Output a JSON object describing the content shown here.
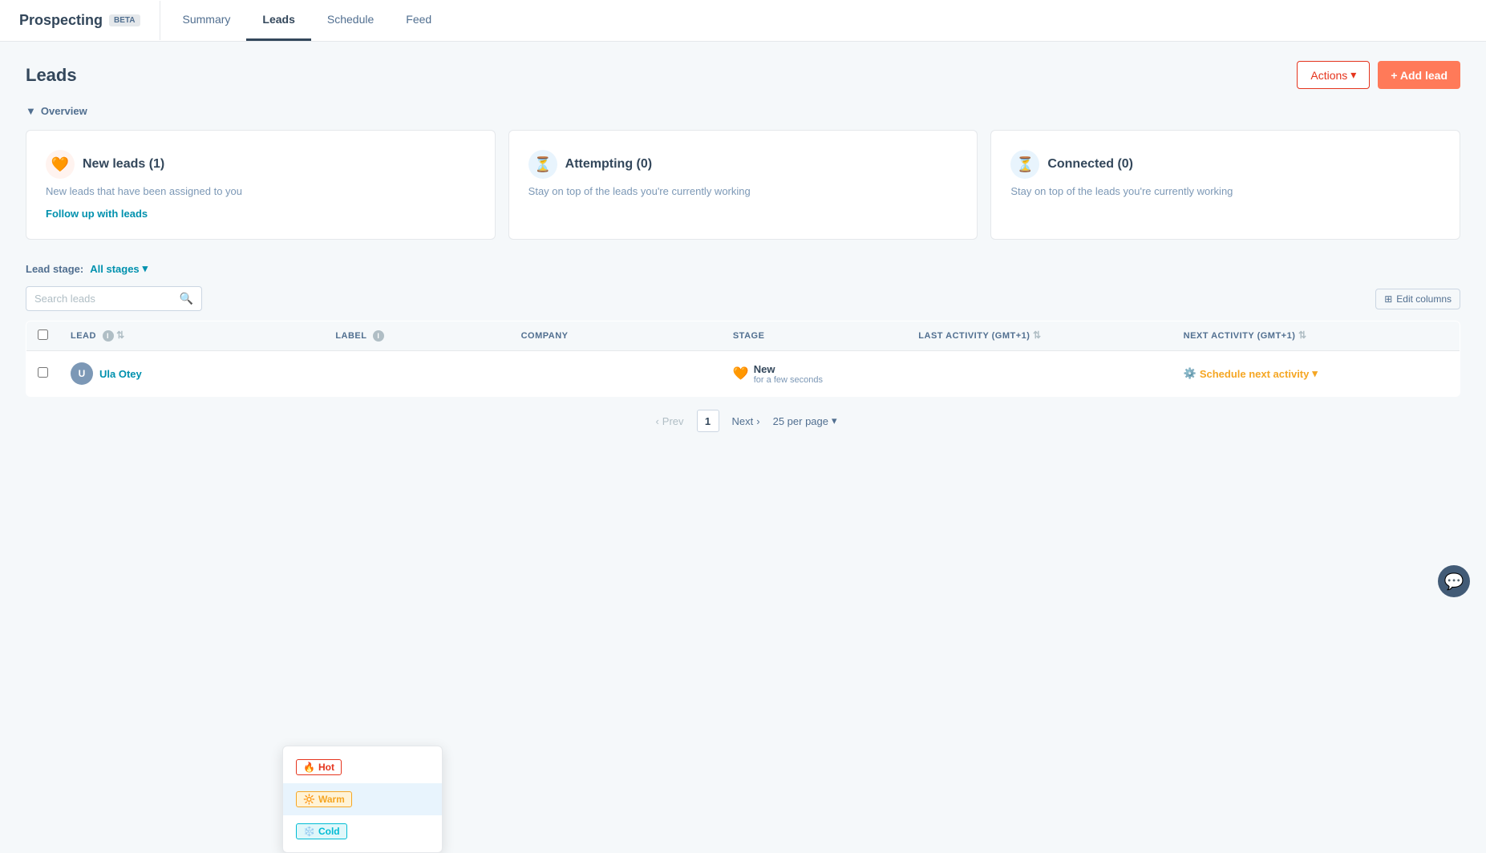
{
  "app": {
    "title": "Prospecting",
    "beta_label": "BETA"
  },
  "nav": {
    "tabs": [
      {
        "id": "summary",
        "label": "Summary",
        "active": false
      },
      {
        "id": "leads",
        "label": "Leads",
        "active": true
      },
      {
        "id": "schedule",
        "label": "Schedule",
        "active": false
      },
      {
        "id": "feed",
        "label": "Feed",
        "active": false
      }
    ]
  },
  "page": {
    "title": "Leads",
    "actions_button": "Actions",
    "add_lead_button": "+ Add lead"
  },
  "overview": {
    "section_label": "Overview",
    "cards": [
      {
        "id": "new-leads",
        "icon": "🧡",
        "icon_type": "orange",
        "title": "New leads (1)",
        "description": "New leads that have been assigned to you",
        "link": "Follow up with leads"
      },
      {
        "id": "attempting",
        "icon": "⏳",
        "icon_type": "blue",
        "title": "Attempting (0)",
        "description": "Stay on top of the leads you're currently working",
        "link": null
      },
      {
        "id": "connected",
        "icon": "⏳",
        "icon_type": "blue",
        "title": "Connected (0)",
        "description": "Stay on top of the leads you're currently working",
        "link": null
      }
    ]
  },
  "filter": {
    "label": "Lead stage:",
    "value": "All stages",
    "chevron": "▾"
  },
  "search": {
    "placeholder": "Search leads"
  },
  "edit_columns_label": "Edit columns",
  "table": {
    "columns": [
      {
        "id": "lead",
        "label": "LEAD",
        "has_info": true,
        "sortable": true
      },
      {
        "id": "label",
        "label": "LABEL",
        "has_info": true,
        "sortable": false
      },
      {
        "id": "company",
        "label": "COMPANY",
        "has_info": false,
        "sortable": false
      },
      {
        "id": "stage",
        "label": "STAGE",
        "has_info": false,
        "sortable": false
      },
      {
        "id": "last_activity",
        "label": "LAST ACTIVITY (GMT+1)",
        "has_info": false,
        "sortable": true
      },
      {
        "id": "next_activity",
        "label": "NEXT ACTIVITY (GMT+1)",
        "has_info": false,
        "sortable": true
      }
    ],
    "rows": [
      {
        "id": "row-1",
        "avatar_initials": "U",
        "name": "Ula Otey",
        "label": "",
        "company": "",
        "stage_icon": "🧡",
        "stage_text": "New",
        "stage_sub": "for a few seconds",
        "last_activity": "",
        "next_activity": "Schedule next activity",
        "next_activity_suffix": "▾"
      }
    ]
  },
  "pagination": {
    "prev_label": "Prev",
    "current_page": "1",
    "next_label": "Next",
    "per_page_label": "25 per page",
    "chevron": "▾"
  },
  "label_dropdown": {
    "options": [
      {
        "id": "hot",
        "emoji": "🔥",
        "label": "Hot",
        "type": "hot",
        "selected": false
      },
      {
        "id": "warm",
        "emoji": "🔆",
        "label": "Warm",
        "type": "warm",
        "selected": true
      },
      {
        "id": "cold",
        "emoji": "❄️",
        "label": "Cold",
        "type": "cold",
        "selected": false
      }
    ]
  }
}
